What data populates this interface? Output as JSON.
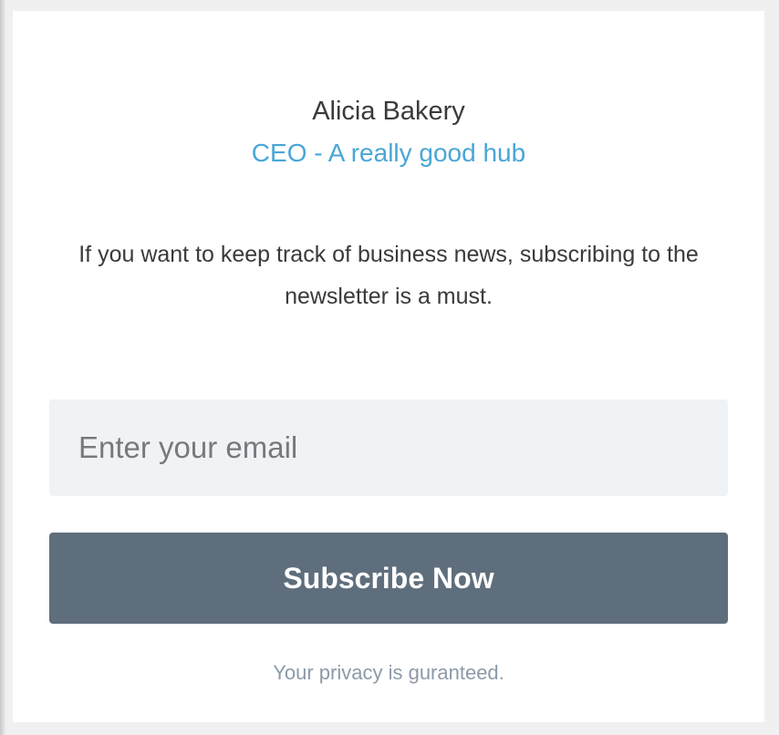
{
  "profile": {
    "name": "Alicia Bakery",
    "role": "CEO - A really good hub"
  },
  "newsletter": {
    "description": "If you want to keep track of business news, subscribing to the newsletter is a must.",
    "email_placeholder": "Enter your email",
    "email_value": "",
    "subscribe_label": "Subscribe Now",
    "privacy_note": "Your privacy is guranteed."
  },
  "colors": {
    "accent": "#4aa6d6",
    "button_bg": "#5f6e7c",
    "input_bg": "#f0f3f6",
    "muted_text": "#8c9aa8"
  }
}
